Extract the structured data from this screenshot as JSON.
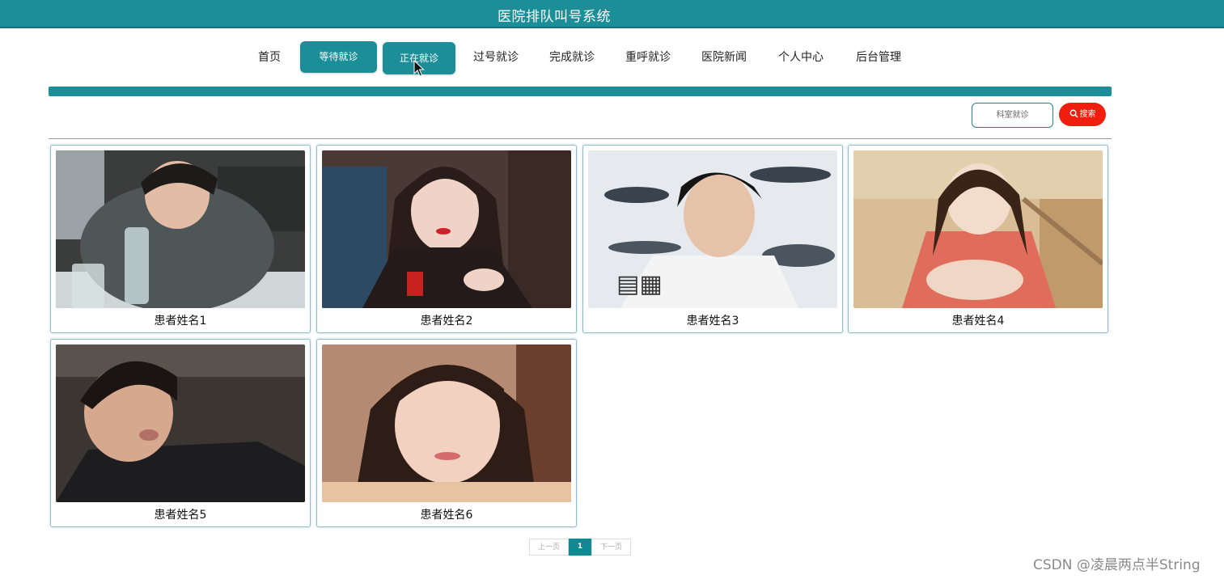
{
  "header": {
    "title": "医院排队叫号系统",
    "color": "#1b8e98"
  },
  "nav": {
    "items": [
      {
        "label": "首页",
        "active": false
      },
      {
        "label": "等待就诊",
        "active": true
      },
      {
        "label": "正在就诊",
        "active": true
      },
      {
        "label": "过号就诊",
        "active": false
      },
      {
        "label": "完成就诊",
        "active": false
      },
      {
        "label": "重呼就诊",
        "active": false
      },
      {
        "label": "医院新闻",
        "active": false
      },
      {
        "label": "个人中心",
        "active": false
      },
      {
        "label": "后台管理",
        "active": false
      }
    ]
  },
  "search": {
    "dept_label": "科室就诊",
    "button_label": "搜索",
    "button_color": "#f01e0f"
  },
  "patients": [
    {
      "name": "患者姓名1"
    },
    {
      "name": "患者姓名2"
    },
    {
      "name": "患者姓名3"
    },
    {
      "name": "患者姓名4"
    },
    {
      "name": "患者姓名5"
    },
    {
      "name": "患者姓名6"
    }
  ],
  "pagination": {
    "prev": "上一页",
    "current": "1",
    "next": "下一页"
  },
  "watermark": "CSDN @凌晨两点半String"
}
